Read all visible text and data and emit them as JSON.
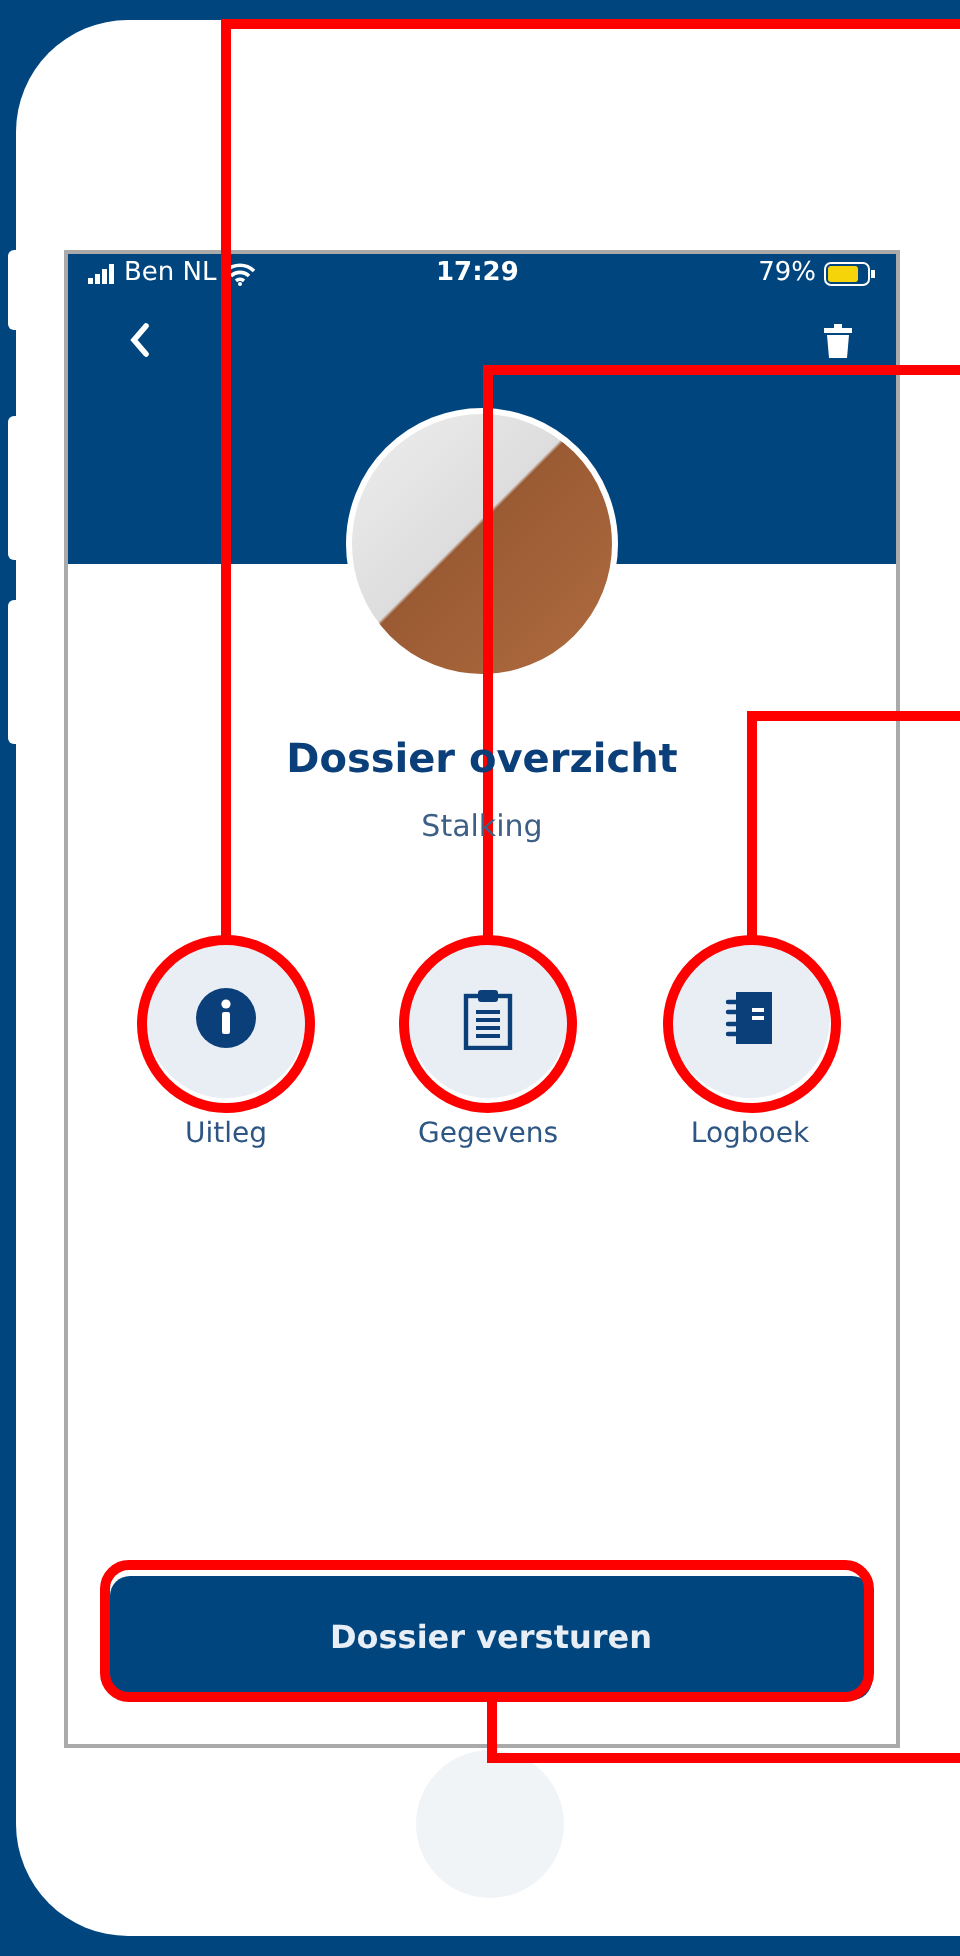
{
  "status_bar": {
    "carrier": "Ben NL",
    "time": "17:29",
    "battery": "79%"
  },
  "header": {
    "title": "Dossier overzicht",
    "subtitle": "Stalking"
  },
  "actions": [
    {
      "label": "Uitleg",
      "kind": "info"
    },
    {
      "label": "Gegevens",
      "kind": "clipboard"
    },
    {
      "label": "Logboek",
      "kind": "notebook"
    }
  ],
  "primary_button": "Dossier versturen"
}
